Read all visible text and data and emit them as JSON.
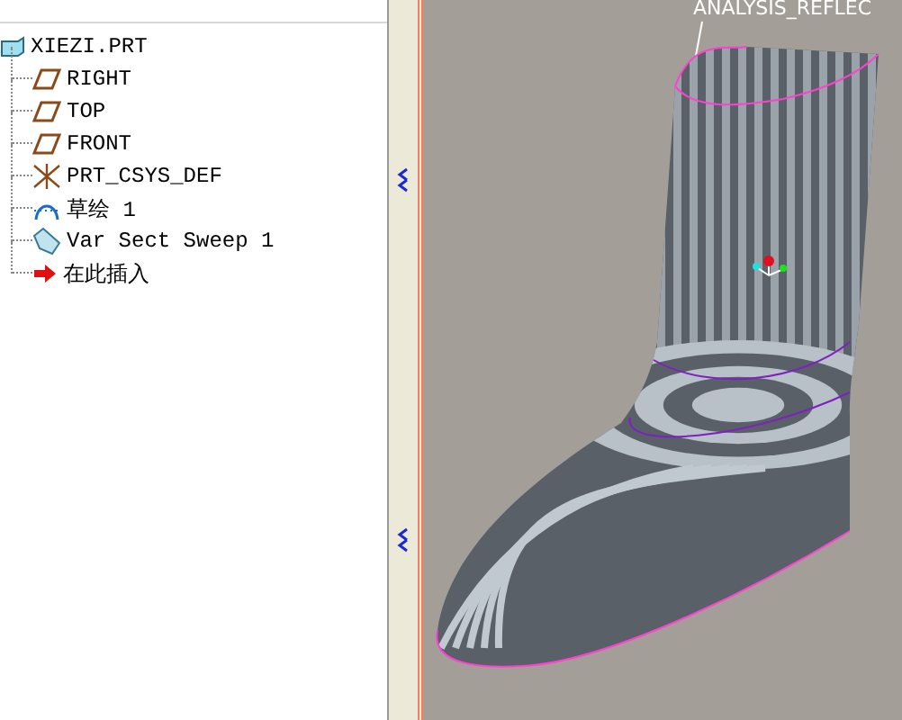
{
  "model_tree": {
    "root": {
      "label": "XIEZI.PRT",
      "kind": "part"
    },
    "children": [
      {
        "label": "RIGHT",
        "kind": "plane"
      },
      {
        "label": "TOP",
        "kind": "plane"
      },
      {
        "label": "FRONT",
        "kind": "plane"
      },
      {
        "label": "PRT_CSYS_DEF",
        "kind": "csys"
      },
      {
        "label": "草绘 1",
        "kind": "sketch"
      },
      {
        "label": "Var Sect Sweep 1",
        "kind": "sweep"
      },
      {
        "label": "在此插入",
        "kind": "insert"
      }
    ]
  },
  "viewport": {
    "analysis_label": "ANALYSIS_REFLEC"
  }
}
